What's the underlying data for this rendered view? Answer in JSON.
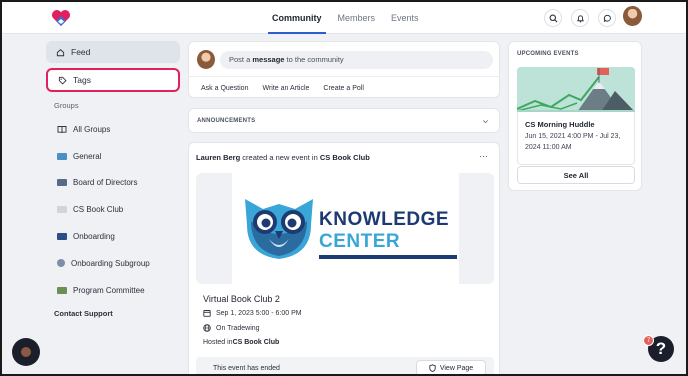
{
  "nav": {
    "tabs": [
      {
        "label": "Community",
        "active": true
      },
      {
        "label": "Members",
        "active": false
      },
      {
        "label": "Events",
        "active": false
      }
    ]
  },
  "sidebar": {
    "feed": "Feed",
    "tags": "Tags",
    "groups_heading": "Groups",
    "groups": [
      {
        "label": "All Groups",
        "icon": "book-icon",
        "color": ""
      },
      {
        "label": "General",
        "icon": "group-flag",
        "color": "#4a90c2"
      },
      {
        "label": "Board of Directors",
        "icon": "group-flag",
        "color": "#556b87"
      },
      {
        "label": "CS Book Club",
        "icon": "group-flag",
        "color": "#c8c8c8"
      },
      {
        "label": "Onboarding",
        "icon": "group-flag",
        "color": "#2a4f86"
      },
      {
        "label": "Onboarding Subgroup",
        "icon": "group-flag",
        "color": "#7e8ea6"
      },
      {
        "label": "Program Committee",
        "icon": "group-flag",
        "color": "#6b8f55"
      }
    ],
    "contact": "Contact Support"
  },
  "composer": {
    "prefix": "Post a ",
    "bold": "message",
    "suffix": " to the community",
    "actions": [
      "Ask a Question",
      "Write an Article",
      "Create a Poll"
    ]
  },
  "announcements": {
    "label": "ANNOUNCEMENTS"
  },
  "post": {
    "author": "Lauren Berg",
    "action_text": " created a new event in ",
    "group": "CS Book Club",
    "menu": "···",
    "image_line1": "KNOWLEDGE",
    "image_line2": "CENTER",
    "event_title": "Virtual Book Club 2",
    "event_date": "Sep 1, 2023 5:00 - 6:00 PM",
    "event_location": "On Tradewing",
    "hosted_prefix": "Hosted in ",
    "hosted_group": "CS Book Club",
    "ended_text": "This event has ended",
    "view_page": "View Page"
  },
  "upcoming": {
    "label": "UPCOMING EVENTS",
    "event_title": "CS Morning Huddle",
    "event_date": "Jun 15, 2021 4:00 PM - Jul 23, 2024 11:00 AM",
    "see_all": "See All"
  },
  "help": {
    "badge": "7",
    "label": "?"
  },
  "colors": {
    "accent": "#2f5bd3",
    "highlight": "#e0215d"
  }
}
